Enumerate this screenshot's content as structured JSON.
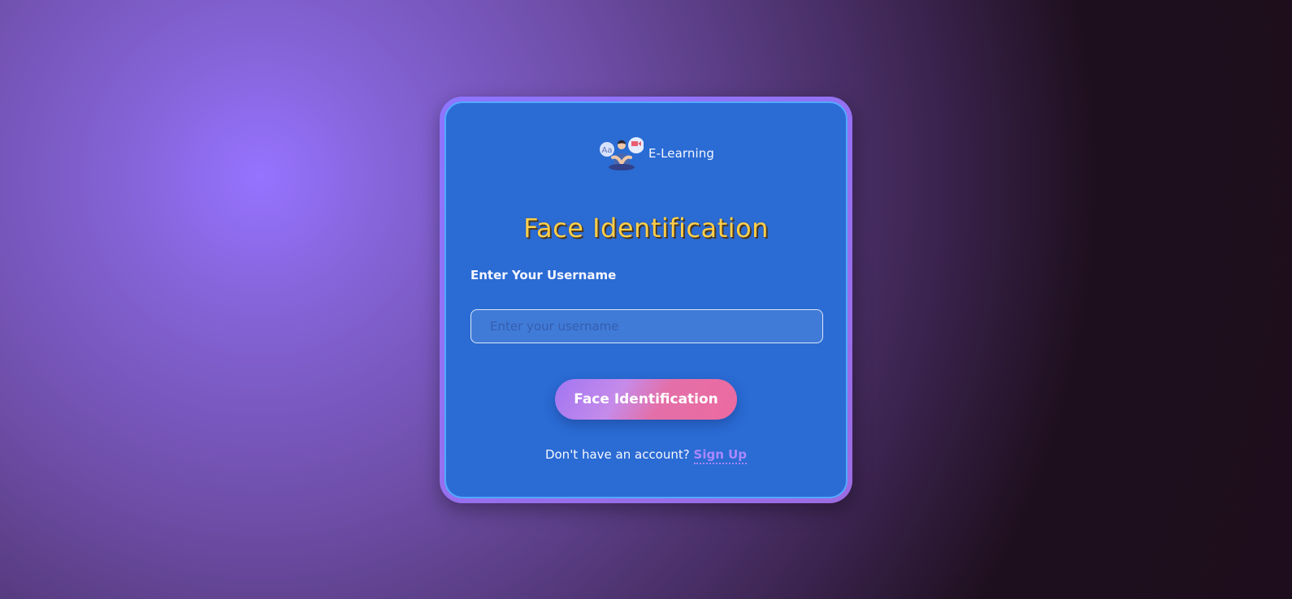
{
  "brand": {
    "name": "E-Learning",
    "logo_icon": "e-learning-logo-icon"
  },
  "form": {
    "title": "Face Identification",
    "username_label": "Enter Your Username",
    "username_placeholder": "Enter your username",
    "username_value": "",
    "submit_label": "Face Identification"
  },
  "footer": {
    "prompt_text": "Don't have an account?",
    "signup_label": "Sign Up"
  },
  "colors": {
    "card_background": "#2a6bd4",
    "card_border": "#8d75ff",
    "title_text": "#ffcf4a",
    "button_gradient_start": "#a176f2",
    "button_gradient_end": "#ec6aa0",
    "link_text": "#aa88ff"
  }
}
